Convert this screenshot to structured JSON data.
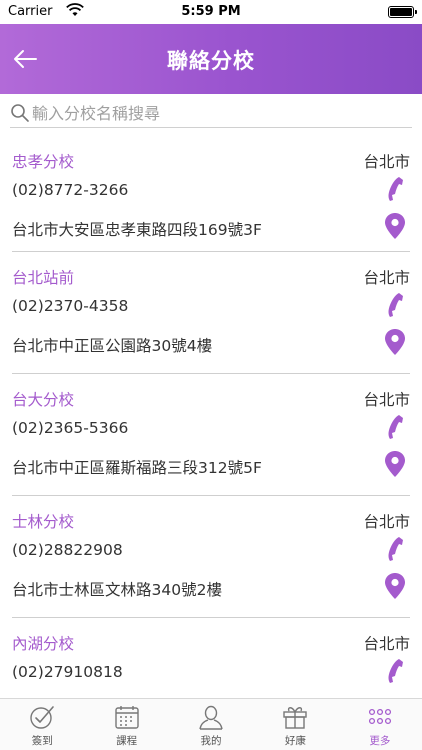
{
  "status_bar": {
    "carrier": "Carrier",
    "time": "5:59 PM"
  },
  "nav": {
    "title": "聯絡分校"
  },
  "search": {
    "placeholder": "輸入分校名稱搜尋"
  },
  "branches": [
    {
      "name": "忠孝分校",
      "city": "台北市",
      "phone": "(02)8772-3266",
      "address": "台北市大安區忠孝東路四段169號3F"
    },
    {
      "name": "台北站前",
      "city": "台北市",
      "phone": "(02)2370-4358",
      "address": "台北市中正區公園路30號4樓"
    },
    {
      "name": "台大分校",
      "city": "台北市",
      "phone": "(02)2365-5366",
      "address": "台北市中正區羅斯福路三段312號5F"
    },
    {
      "name": "士林分校",
      "city": "台北市",
      "phone": "(02)28822908",
      "address": "台北市士林區文林路340號2樓"
    },
    {
      "name": "內湖分校",
      "city": "台北市",
      "phone": "(02)27910818",
      "address": ""
    }
  ],
  "tabs": [
    {
      "label": "簽到",
      "icon": "checkmark-circle-icon"
    },
    {
      "label": "課程",
      "icon": "calendar-icon"
    },
    {
      "label": "我的",
      "icon": "person-icon"
    },
    {
      "label": "好康",
      "icon": "gift-icon"
    },
    {
      "label": "更多",
      "icon": "more-dots-icon",
      "active": true
    }
  ],
  "colors": {
    "accent": "#a45bcd",
    "nav_start": "#b26ad8",
    "nav_end": "#8a4bc6"
  }
}
